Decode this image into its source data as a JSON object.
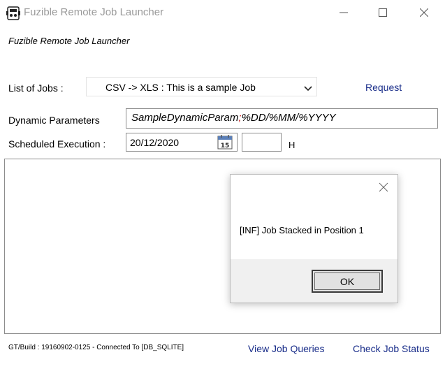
{
  "window": {
    "title": "Fuzible Remote Job Launcher"
  },
  "header": {
    "subtitle": "Fuzible Remote Job Launcher"
  },
  "form": {
    "jobs_label": "List of Jobs :",
    "jobs_selected": "CSV -> XLS : This is a sample Job",
    "request_link": "Request",
    "dynamic_label": "Dynamic Parameters",
    "dynamic_value_part1": "SampleDynamicParam",
    "dynamic_separator": ";",
    "dynamic_value_part2": "%DD/%MM/%YYYY",
    "schedule_label": "Scheduled Execution :",
    "schedule_date": "20/12/2020",
    "calendar_day": "15",
    "hour_value": "",
    "hour_label": "H"
  },
  "dialog": {
    "message": "[INF] Job Stacked in Position 1",
    "ok_label": "OK"
  },
  "footer": {
    "status": "GT/Build : 19160902-0125 - Connected To [DB_SQLITE]",
    "view_queries": "View Job Queries",
    "check_status": "Check Job Status"
  },
  "colors": {
    "link": "#1a2e8a",
    "separator": "#d21d1d",
    "title_text": "#9a9a9a"
  }
}
